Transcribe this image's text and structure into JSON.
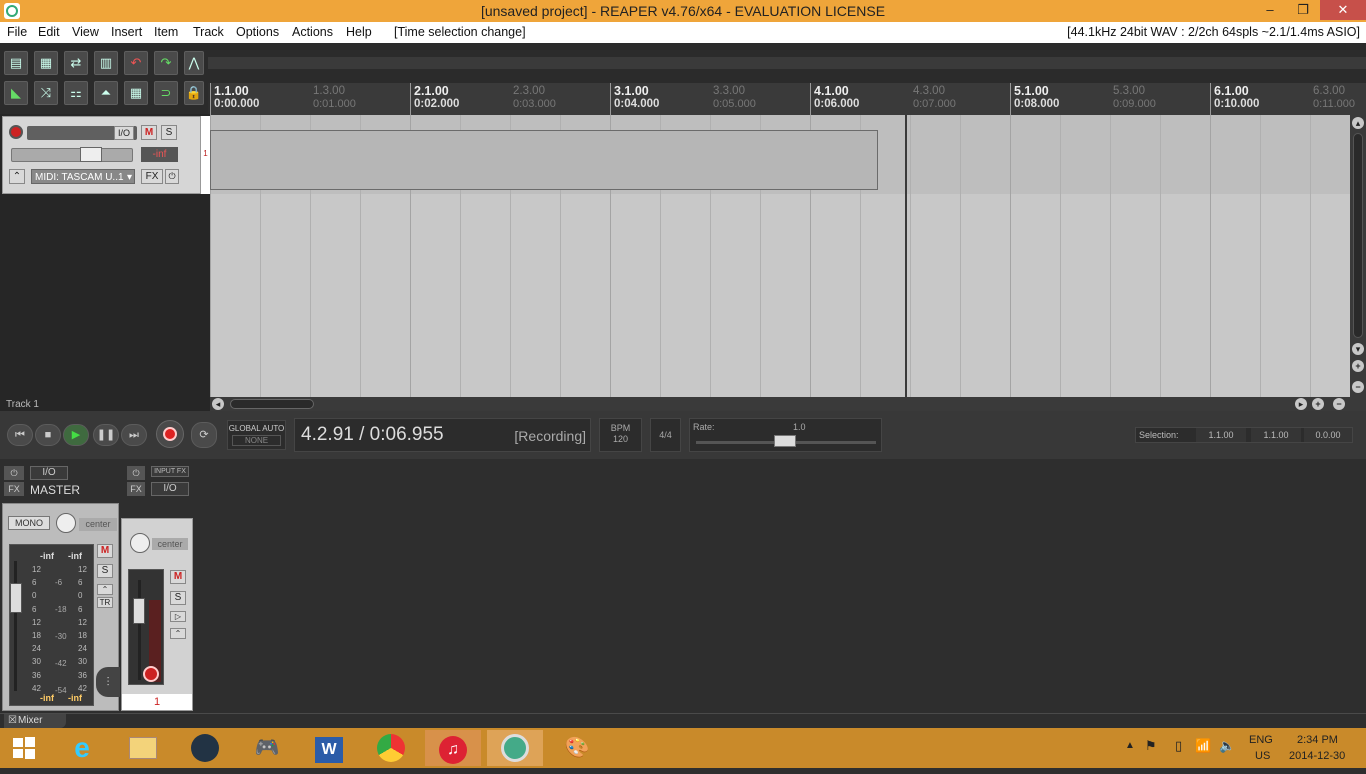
{
  "window": {
    "title": "[unsaved project] - REAPER v4.76/x64 - EVALUATION LICENSE",
    "min_label": "–",
    "max_label": "❐",
    "close_label": "✕"
  },
  "menu": {
    "items": [
      "File",
      "Edit",
      "View",
      "Insert",
      "Item",
      "Track",
      "Options",
      "Actions",
      "Help"
    ],
    "undo_hint": "[Time selection change]",
    "audio_info": "[44.1kHz 24bit WAV : 2/2ch 64spls ~2.1/1.4ms ASIO]"
  },
  "ruler": {
    "major": [
      {
        "bar": "1.1.00",
        "time": "0:00.000"
      },
      {
        "bar": "2.1.00",
        "time": "0:02.000"
      },
      {
        "bar": "3.1.00",
        "time": "0:04.000"
      },
      {
        "bar": "4.1.00",
        "time": "0:06.000"
      },
      {
        "bar": "5.1.00",
        "time": "0:08.000"
      },
      {
        "bar": "6.1.00",
        "time": "0:10.000"
      }
    ],
    "minor": [
      {
        "bar": "1.3.00",
        "time": "0:01.000"
      },
      {
        "bar": "2.3.00",
        "time": "0:03.000"
      },
      {
        "bar": "3.3.00",
        "time": "0:05.000"
      },
      {
        "bar": "4.3.00",
        "time": "0:07.000"
      },
      {
        "bar": "5.3.00",
        "time": "0:09.000"
      },
      {
        "bar": "6.3.00",
        "time": "0:11.000"
      }
    ]
  },
  "track": {
    "io_label": "I/O",
    "mute_label": "M",
    "solo_label": "S",
    "volume_readout": "-inf",
    "input_label": "MIDI: TASCAM U..1",
    "fx_label": "FX",
    "number": "1",
    "footer_label": "Track 1"
  },
  "transport": {
    "global_auto_label": "GLOBAL AUTO",
    "global_auto_value": "NONE",
    "position": "4.2.91 / 0:06.955",
    "state": "[Recording]",
    "bpm_label": "BPM",
    "bpm_value": "120",
    "time_sig": "4/4",
    "rate_label": "Rate:",
    "rate_value": "1.0",
    "selection_label": "Selection:",
    "selection_start": "1.1.00",
    "selection_end": "1.1.00",
    "selection_length": "0.0.00"
  },
  "mixer": {
    "master_label": "MASTER",
    "io_label": "I/O",
    "fx_label": "FX",
    "mono_label": "MONO",
    "pan_label": "center",
    "peak_left": "-inf",
    "peak_right": "-inf",
    "mute_label": "M",
    "solo_label": "S",
    "tr_label": "TR",
    "scale_left": [
      "12",
      "6",
      "0",
      "6",
      "12",
      "18",
      "24",
      "30",
      "36",
      "42"
    ],
    "scale_mid": [
      "-6",
      "-18",
      "-30",
      "-42",
      "-54"
    ],
    "scale_right": [
      "12",
      "6",
      "0",
      "6",
      "12",
      "18",
      "24",
      "30",
      "36",
      "42"
    ],
    "bottom_left": "-inf",
    "bottom_right": "-inf",
    "track_input_fx": "INPUT FX",
    "track_pan_label": "center",
    "track_number": "1",
    "tab_label": "Mixer"
  },
  "taskbar": {
    "lang_top": "ENG",
    "lang_bottom": "US",
    "time": "2:34 PM",
    "date": "2014-12-30"
  }
}
